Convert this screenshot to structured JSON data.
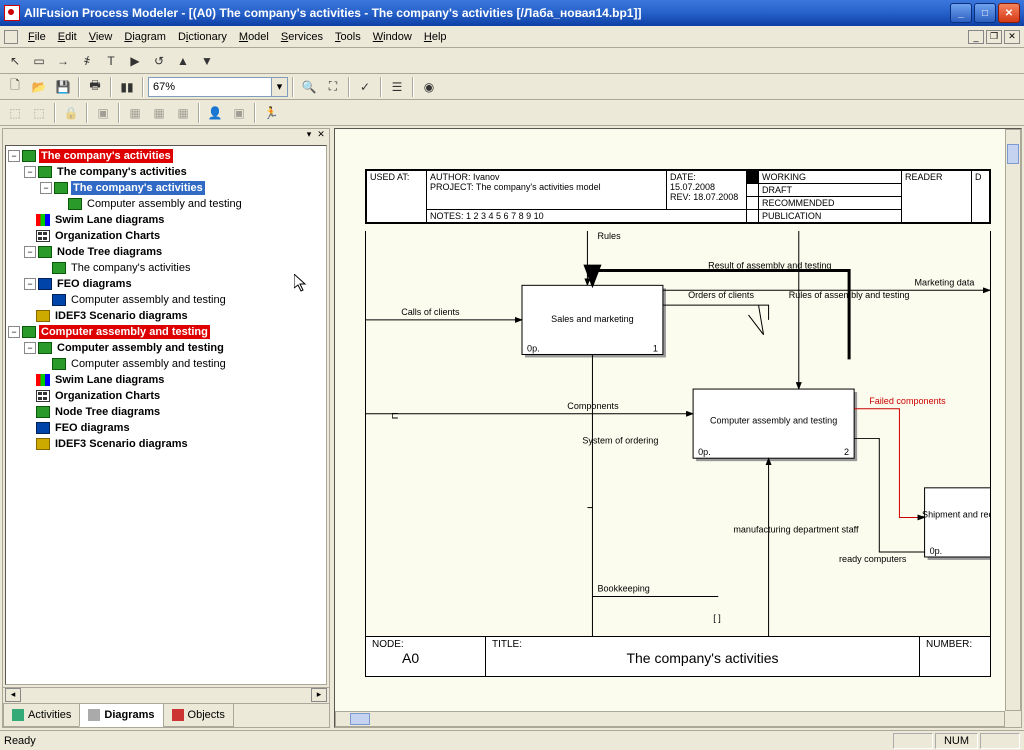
{
  "window": {
    "title": "AllFusion Process Modeler - [(A0) The company's activities - The company's activities [/Лаба_новая14.bp1]]"
  },
  "menu": {
    "items": [
      "File",
      "Edit",
      "View",
      "Diagram",
      "Dictionary",
      "Model",
      "Services",
      "Tools",
      "Window",
      "Help"
    ]
  },
  "zoom": "67%",
  "tree": {
    "n0": "The company's activities",
    "n1": "The company's activities",
    "n2": "The company's activities",
    "n3": "Computer assembly and testing",
    "n4": "Swim Lane diagrams",
    "n5": "Organization Charts",
    "n6": "Node Tree diagrams",
    "n7": "The company's activities",
    "n8": "FEO diagrams",
    "n9": "Computer assembly and testing",
    "n10": "IDEF3 Scenario diagrams",
    "n11": "Computer assembly and testing",
    "n12": "Computer assembly and testing",
    "n13": "Computer assembly and testing",
    "n14": "Swim Lane diagrams",
    "n15": "Organization Charts",
    "n16": "Node Tree diagrams",
    "n17": "FEO diagrams",
    "n18": "IDEF3 Scenario diagrams"
  },
  "tabs": {
    "activities": "Activities",
    "diagrams": "Diagrams",
    "objects": "Objects"
  },
  "header": {
    "used_at": "USED AT:",
    "author_lbl": "AUTHOR:",
    "author": "Ivanov",
    "project_lbl": "PROJECT:",
    "project": "The company's activities model",
    "notes_lbl": "NOTES:",
    "notes": "1 2 3 4 5 6 7 8 9 10",
    "date_lbl": "DATE:",
    "date": "15.07.2008",
    "rev_lbl": "REV:",
    "rev": "18.07.2008",
    "working": "WORKING",
    "draft": "DRAFT",
    "recommended": "RECOMMENDED",
    "publication": "PUBLICATION",
    "reader": "READER",
    "d": "D"
  },
  "diagram": {
    "rules": "Rules",
    "calls": "Calls of clients",
    "sales": "Sales and marketing",
    "idx1": "0р.",
    "num1": "1",
    "result": "Result of assembly and testing",
    "orders": "Orders of clients",
    "rules_at": "Rules of assembly and testing",
    "marketing": "Marketing data",
    "components": "Components",
    "assembly": "Computer assembly and testing",
    "idx2": "0р.",
    "num2": "2",
    "failed": "Failed components",
    "system": "System of ordering",
    "shipment": "Shipment and receipt",
    "idx3": "0р.",
    "staff": "manufacturing department staff",
    "ready": "ready computers",
    "bookkeeping": "Bookkeeping"
  },
  "footer": {
    "node_lbl": "NODE:",
    "node": "A0",
    "title_lbl": "TITLE:",
    "title": "The company's activities",
    "number_lbl": "NUMBER:"
  },
  "status": {
    "ready": "Ready",
    "num": "NUM"
  }
}
